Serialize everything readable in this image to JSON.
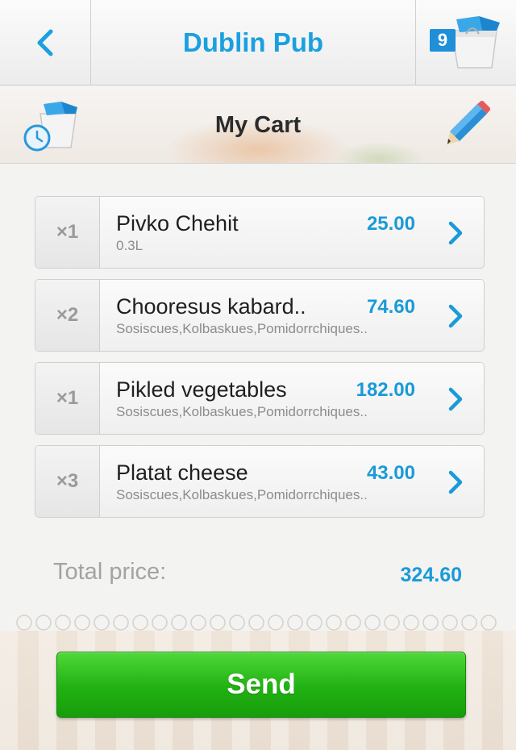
{
  "header": {
    "title": "Dublin Pub",
    "cart_count": "9"
  },
  "banner": {
    "title": "My Cart"
  },
  "cart": {
    "items": [
      {
        "qty": "×1",
        "name": "Pivko Chehit",
        "desc": "0.3L",
        "price": "25.00"
      },
      {
        "qty": "×2",
        "name": "Chooresus kabard..",
        "desc": "Sosiscues,Kolbaskues,Pomidorrchiques..",
        "price": "74.60"
      },
      {
        "qty": "×1",
        "name": "Pikled vegetables",
        "desc": "Sosiscues,Kolbaskues,Pomidorrchiques..",
        "price": "182.00"
      },
      {
        "qty": "×3",
        "name": "Platat cheese",
        "desc": "Sosiscues,Kolbaskues,Pomidorrchiques..",
        "price": "43.00"
      }
    ]
  },
  "total": {
    "label": "Total price:",
    "value": "324.60"
  },
  "actions": {
    "send_label": "Send"
  },
  "colors": {
    "accent": "#1a9ad8",
    "send": "#21b112"
  },
  "icons": {
    "back": "chevron-left-icon",
    "cart": "shopping-bag-icon",
    "order_timer": "bag-clock-icon",
    "edit": "pencil-icon",
    "item_open": "chevron-right-icon"
  }
}
